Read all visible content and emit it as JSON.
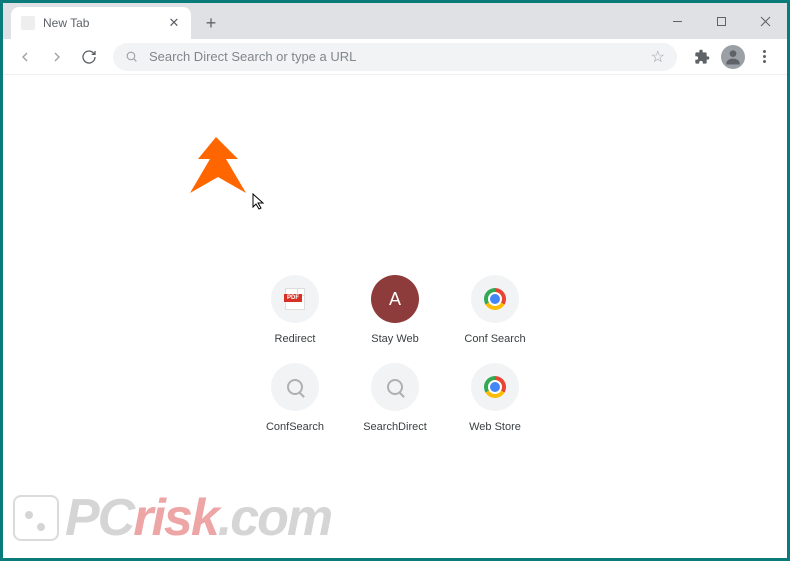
{
  "tab": {
    "title": "New Tab"
  },
  "omnibox": {
    "placeholder": "Search Direct Search or type a URL"
  },
  "shortcuts": [
    {
      "label": "Redirect",
      "icon": "pdf"
    },
    {
      "label": "Stay Web",
      "icon": "letter",
      "letter": "A"
    },
    {
      "label": "Conf Search",
      "icon": "chrome"
    },
    {
      "label": "ConfSearch",
      "icon": "mag"
    },
    {
      "label": "SearchDirect",
      "icon": "mag"
    },
    {
      "label": "Web Store",
      "icon": "chrome"
    }
  ],
  "watermark": {
    "prefix": "PC",
    "risk": "risk",
    "suffix": ".com"
  }
}
